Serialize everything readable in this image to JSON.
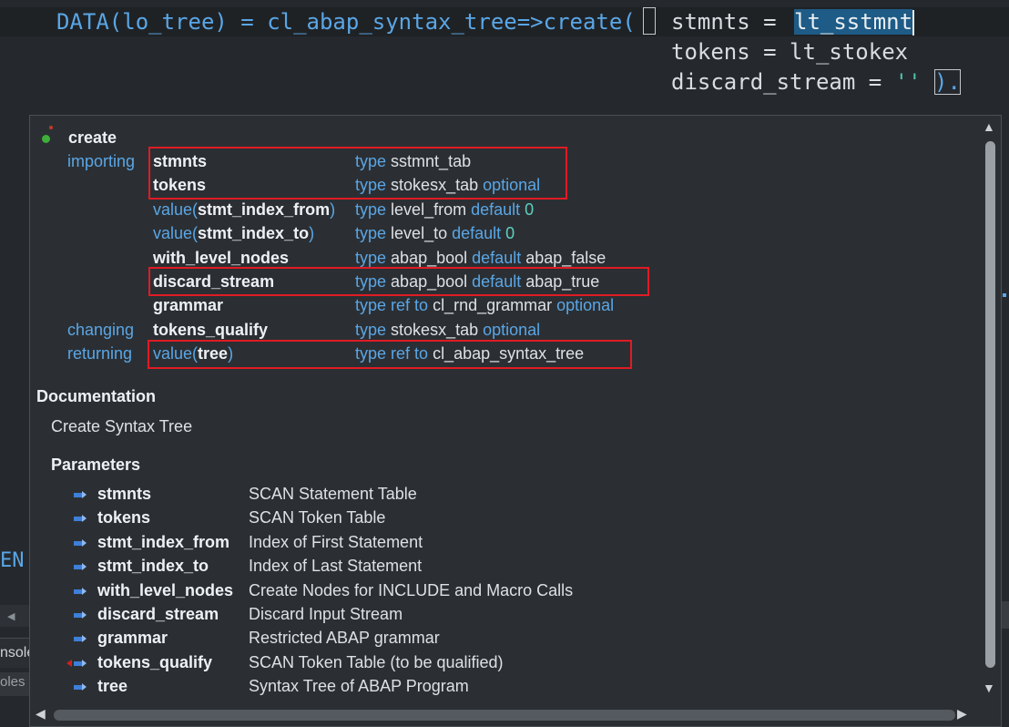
{
  "editor": {
    "line1_prefix": "DATA(lo_tree) = cl_abap_syntax_tree=>create(",
    "line1_param": "stmnts = ",
    "line1_selected": "lt_sstmnt",
    "line2": "tokens = lt_stokex",
    "line3_prefix": "discard_stream = ",
    "line3_string": "''",
    "line3_suffix": ").",
    "end_fragment": "EN",
    "console_tab": "nsole",
    "console_tab2": "oles"
  },
  "popup": {
    "method_name": "create",
    "signature": [
      {
        "section": "importing",
        "pre": "",
        "name": "stmnts",
        "post": "",
        "type_kw": "type",
        "type_name": "sstmnt_tab",
        "extra_kw": "",
        "extra_val": ""
      },
      {
        "section": "",
        "pre": "",
        "name": "tokens",
        "post": "",
        "type_kw": "type",
        "type_name": "stokesx_tab",
        "extra_kw": "optional",
        "extra_val": ""
      },
      {
        "section": "",
        "pre": "value(",
        "name": "stmt_index_from",
        "post": ")",
        "type_kw": "type",
        "type_name": "level_from",
        "extra_kw": "default",
        "extra_val": "0"
      },
      {
        "section": "",
        "pre": "value(",
        "name": "stmt_index_to",
        "post": ")",
        "type_kw": "type",
        "type_name": "level_to",
        "extra_kw": "default",
        "extra_val": "0"
      },
      {
        "section": "",
        "pre": "",
        "name": "with_level_nodes",
        "post": "",
        "type_kw": "type",
        "type_name": "abap_bool",
        "extra_kw": "default",
        "extra_val": "abap_false"
      },
      {
        "section": "",
        "pre": "",
        "name": "discard_stream",
        "post": "",
        "type_kw": "type",
        "type_name": "abap_bool",
        "extra_kw": "default",
        "extra_val": "abap_true"
      },
      {
        "section": "",
        "pre": "",
        "name": "grammar",
        "post": "",
        "type_kw": "type ref to",
        "type_name": "cl_rnd_grammar",
        "extra_kw": "optional",
        "extra_val": ""
      },
      {
        "section": "changing",
        "pre": "",
        "name": "tokens_qualify",
        "post": "",
        "type_kw": "type",
        "type_name": "stokesx_tab",
        "extra_kw": "optional",
        "extra_val": ""
      },
      {
        "section": "returning",
        "pre": "value(",
        "name": "tree",
        "post": ")",
        "type_kw": "type ref to",
        "type_name": "cl_abap_syntax_tree",
        "extra_kw": "",
        "extra_val": ""
      }
    ],
    "documentation_heading": "Documentation",
    "documentation_text": "Create Syntax Tree",
    "parameters_heading": "Parameters",
    "parameters": [
      {
        "name": "stmnts",
        "desc": "SCAN Statement Table"
      },
      {
        "name": "tokens",
        "desc": "SCAN Token Table"
      },
      {
        "name": "stmt_index_from",
        "desc": "Index of First Statement"
      },
      {
        "name": "stmt_index_to",
        "desc": "Index of Last Statement"
      },
      {
        "name": "with_level_nodes",
        "desc": "Create Nodes for INCLUDE and Macro Calls"
      },
      {
        "name": "discard_stream",
        "desc": "Discard Input Stream"
      },
      {
        "name": "grammar",
        "desc": "Restricted ABAP grammar"
      },
      {
        "name": "tokens_qualify",
        "desc": "SCAN Token Table (to be qualified)"
      },
      {
        "name": "tree",
        "desc": "Syntax Tree of ABAP Program"
      }
    ]
  },
  "colors": {
    "keyword_blue": "#5aa6e6",
    "highlight_red": "#e01b24",
    "selection": "#1e5b86",
    "popup_bg": "#2b2f33"
  }
}
